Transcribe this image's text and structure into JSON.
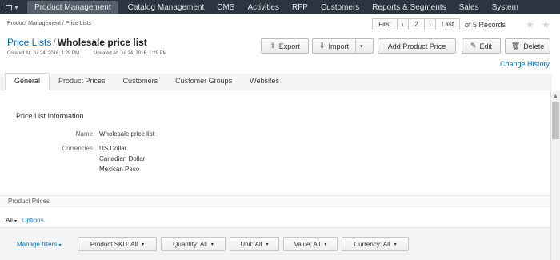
{
  "nav": {
    "apps_caret": "▾",
    "items": [
      "Product Management",
      "Catalog Management",
      "CMS",
      "Activities",
      "RFP",
      "Customers",
      "Reports & Segments",
      "Sales",
      "System"
    ]
  },
  "breadcrumb": "Product Management / Price Lists",
  "pager": {
    "first": "First",
    "prev": "‹",
    "page": "2",
    "next": "›",
    "last": "Last",
    "count": "of 5 Records"
  },
  "title": {
    "parent": "Price Lists",
    "separator": "/",
    "name": "Wholesale price list"
  },
  "meta": {
    "created": "Created At: Jul 24, 2016, 1:29 PM",
    "updated": "Updated At: Jul 24, 2016, 1:29 PM"
  },
  "actions": {
    "export": "Export",
    "import": "Import",
    "add_product_price": "Add Product Price",
    "edit": "Edit",
    "delete": "Delete",
    "change_history": "Change History"
  },
  "tabs": [
    "General",
    "Product Prices",
    "Customers",
    "Customer Groups",
    "Websites"
  ],
  "info": {
    "section_title": "Price List Information",
    "name_label": "Name",
    "name_value": "Wholesale price list",
    "currencies_label": "Currencies",
    "currencies": [
      "US Dollar",
      "Canadian Dollar",
      "Mexican Peso"
    ]
  },
  "product_prices": {
    "header": "Product Prices",
    "all": "All",
    "options": "Options",
    "manage_filters": "Manage filters",
    "filters": [
      "Product SKU: All",
      "Quantity: All",
      "Unit: All",
      "Value: All",
      "Currency: All"
    ]
  },
  "colors": {
    "nav_bg": "#2b3540",
    "link": "#0c6eb9"
  }
}
